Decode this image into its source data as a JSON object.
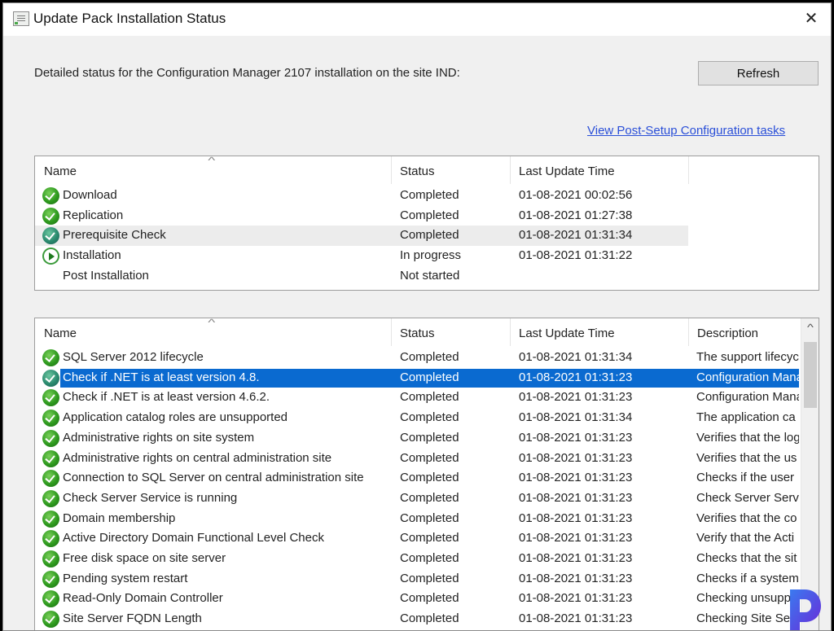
{
  "window": {
    "title": "Update Pack Installation Status",
    "close_label": "✕"
  },
  "main": {
    "description": "Detailed status for the Configuration Manager 2107 installation on the site IND:",
    "refresh_label": "Refresh",
    "post_setup_link": "View Post-Setup Configuration tasks"
  },
  "phases": {
    "columns": [
      "Name",
      "Status",
      "Last Update Time"
    ],
    "rows": [
      {
        "icon": "ok",
        "name": "Download",
        "status": "Completed",
        "time": "01-08-2021 00:02:56"
      },
      {
        "icon": "ok",
        "name": "Replication",
        "status": "Completed",
        "time": "01-08-2021 01:27:38"
      },
      {
        "icon": "ok-teal",
        "name": "Prerequisite Check",
        "status": "Completed",
        "time": "01-08-2021 01:31:34"
      },
      {
        "icon": "play",
        "name": "Installation",
        "status": "In progress",
        "time": "01-08-2021 01:31:22"
      },
      {
        "icon": "none",
        "name": "Post Installation",
        "status": "Not started",
        "time": ""
      }
    ]
  },
  "details": {
    "columns": [
      "Name",
      "Status",
      "Last Update Time",
      "Description"
    ],
    "rows": [
      {
        "name": "SQL Server 2012 lifecycle",
        "status": "Completed",
        "time": "01-08-2021 01:31:34",
        "desc": "The support lifecyc"
      },
      {
        "name": "Check if .NET is at least version 4.8.",
        "status": "Completed",
        "time": "01-08-2021 01:31:23",
        "desc": "Configuration Mana"
      },
      {
        "name": "Check if .NET is at least version 4.6.2.",
        "status": "Completed",
        "time": "01-08-2021 01:31:23",
        "desc": "Configuration Mana"
      },
      {
        "name": "Application catalog roles are unsupported",
        "status": "Completed",
        "time": "01-08-2021 01:31:34",
        "desc": "The application ca"
      },
      {
        "name": "Administrative rights on site system",
        "status": "Completed",
        "time": "01-08-2021 01:31:23",
        "desc": "Verifies that the log"
      },
      {
        "name": "Administrative rights on central administration site",
        "status": "Completed",
        "time": "01-08-2021 01:31:23",
        "desc": "Verifies that the us"
      },
      {
        "name": "Connection to SQL Server on central administration site",
        "status": "Completed",
        "time": "01-08-2021 01:31:23",
        "desc": "Checks if the user"
      },
      {
        "name": "Check Server Service is running",
        "status": "Completed",
        "time": "01-08-2021 01:31:23",
        "desc": "Check Server Serv"
      },
      {
        "name": "Domain membership",
        "status": "Completed",
        "time": "01-08-2021 01:31:23",
        "desc": "Verifies that the co"
      },
      {
        "name": "Active Directory Domain Functional Level Check",
        "status": "Completed",
        "time": "01-08-2021 01:31:23",
        "desc": "Verify that the Acti"
      },
      {
        "name": "Free disk space on site server",
        "status": "Completed",
        "time": "01-08-2021 01:31:23",
        "desc": "Checks that the sit"
      },
      {
        "name": "Pending system restart",
        "status": "Completed",
        "time": "01-08-2021 01:31:23",
        "desc": "Checks if a system"
      },
      {
        "name": "Read-Only Domain Controller",
        "status": "Completed",
        "time": "01-08-2021 01:31:23",
        "desc": "Checking unsuppo"
      },
      {
        "name": "Site Server FQDN Length",
        "status": "Completed",
        "time": "01-08-2021 01:31:23",
        "desc": "Checking Site Serv"
      }
    ],
    "selected_index": 1
  },
  "colors": {
    "selection": "#0a6ad0",
    "link": "#2a4fd8",
    "success": "#2e9a1e"
  }
}
